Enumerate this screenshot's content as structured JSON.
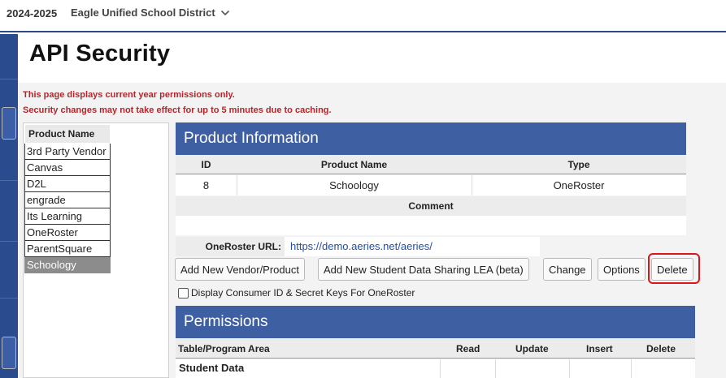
{
  "header": {
    "year": "2024-2025",
    "district": "Eagle Unified School District"
  },
  "page": {
    "title": "API Security",
    "warning1": "This page displays current year permissions only.",
    "warning2": "Security changes may not take effect for up to 5 minutes due to caching."
  },
  "product_list": {
    "header": "Product Name",
    "items": [
      "3rd Party Vendor",
      "Canvas",
      "D2L",
      "engrade",
      "Its Learning",
      "OneRoster",
      "ParentSquare",
      "Schoology"
    ],
    "selected": "Schoology"
  },
  "product_info": {
    "title": "Product Information",
    "columns": [
      "ID",
      "Product Name",
      "Type"
    ],
    "row": {
      "id": "8",
      "name": "Schoology",
      "type": "OneRoster"
    },
    "comment_label": "Comment",
    "comment_value": "",
    "url_label": "OneRoster URL:",
    "url_value": "https://demo.aeries.net/aeries/"
  },
  "buttons": {
    "add_vendor": "Add New Vendor/Product",
    "add_lea": "Add New Student Data Sharing LEA (beta)",
    "change": "Change",
    "options": "Options",
    "delete": "Delete"
  },
  "checkbox": {
    "label": "Display Consumer ID & Secret Keys For OneRoster",
    "checked": false
  },
  "permissions": {
    "title": "Permissions",
    "columns": [
      "Table/Program Area",
      "Read",
      "Update",
      "Insert",
      "Delete"
    ],
    "first_row": "Student Data"
  },
  "colors": {
    "panel_header": "#3f5fa3",
    "nav_rail": "#2a4b8d",
    "warning": "#b3262c",
    "highlight": "#d9161c",
    "link": "#1f4ea8",
    "selected_item": "#8c8c8c"
  }
}
